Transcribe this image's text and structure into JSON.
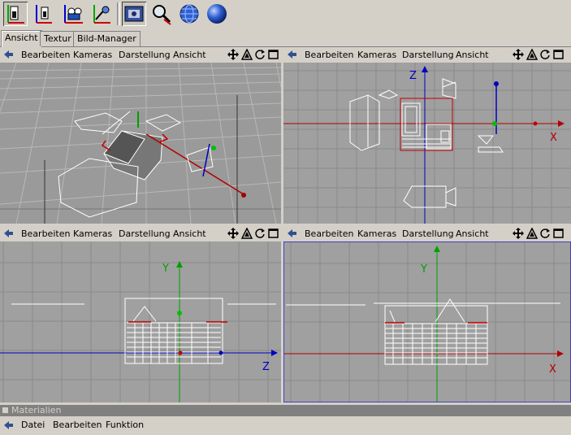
{
  "toolbar": {
    "icons": [
      "scale-tool-icon",
      "rotate-tool-icon",
      "camera-tool-icon",
      "coordinate-tool-icon",
      "viewport-render-icon",
      "search-render-icon",
      "globe-render-icon",
      "sphere-render-icon"
    ]
  },
  "tabs": [
    {
      "label": "Ansicht"
    },
    {
      "label": "Textur"
    },
    {
      "label": "Bild-Manager"
    }
  ],
  "viewport_menu": {
    "edit": "Bearbeiten",
    "cameras": "Kameras",
    "display": "Darstellung",
    "view": "Ansicht"
  },
  "axes": {
    "x": "X",
    "y": "Y",
    "z": "Z"
  },
  "materials": {
    "title": "Materialien",
    "menu": {
      "file": "Datei",
      "edit": "Bearbeiten",
      "function": "Funktion"
    }
  },
  "colors": {
    "active_border": "#4040c0",
    "axis_red": "#b00000",
    "axis_green": "#00a000",
    "axis_blue": "#0000c0",
    "grid_bg": "#a0a0a0"
  }
}
